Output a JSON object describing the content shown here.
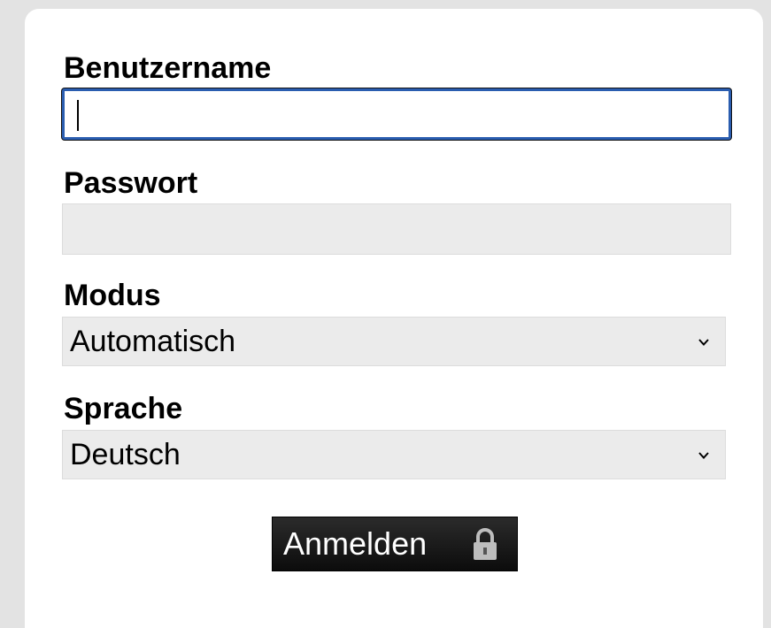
{
  "form": {
    "username": {
      "label": "Benutzername",
      "value": ""
    },
    "password": {
      "label": "Passwort",
      "value": ""
    },
    "mode": {
      "label": "Modus",
      "selected": "Automatisch"
    },
    "language": {
      "label": "Sprache",
      "selected": "Deutsch"
    },
    "submit": {
      "label": "Anmelden",
      "icon": "lock-icon"
    }
  },
  "colors": {
    "focus_border": "#2a5db0",
    "field_bg": "#ebebeb",
    "button_bg": "#1a1a1a",
    "page_bg": "#e3e3e3"
  }
}
